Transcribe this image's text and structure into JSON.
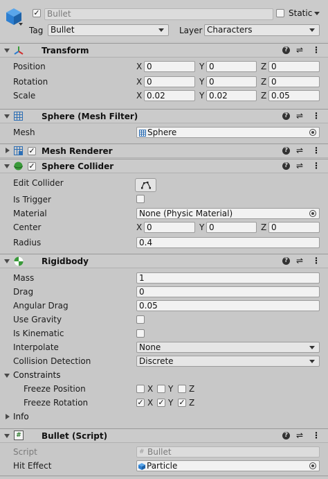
{
  "object": {
    "name": "Bullet",
    "static_label": "Static",
    "tag_label": "Tag",
    "tag_value": "Bullet",
    "layer_label": "Layer",
    "layer_value": "Characters"
  },
  "axes": {
    "x": "X",
    "y": "Y",
    "z": "Z"
  },
  "transform": {
    "title": "Transform",
    "position_label": "Position",
    "position": [
      "0",
      "0",
      "0"
    ],
    "rotation_label": "Rotation",
    "rotation": [
      "0",
      "0",
      "0"
    ],
    "scale_label": "Scale",
    "scale": [
      "0.02",
      "0.02",
      "0.05"
    ]
  },
  "mesh_filter": {
    "title": "Sphere (Mesh Filter)",
    "mesh_label": "Mesh",
    "mesh_value": "Sphere"
  },
  "mesh_renderer": {
    "title": "Mesh Renderer"
  },
  "sphere_collider": {
    "title": "Sphere Collider",
    "edit_label": "Edit Collider",
    "trigger_label": "Is Trigger",
    "material_label": "Material",
    "material_value": "None (Physic Material)",
    "center_label": "Center",
    "center": [
      "0",
      "0",
      "0"
    ],
    "radius_label": "Radius",
    "radius": "0.4"
  },
  "rigidbody": {
    "title": "Rigidbody",
    "mass_label": "Mass",
    "mass": "1",
    "drag_label": "Drag",
    "drag": "0",
    "angular_drag_label": "Angular Drag",
    "angular_drag": "0.05",
    "use_gravity_label": "Use Gravity",
    "is_kinematic_label": "Is Kinematic",
    "interpolate_label": "Interpolate",
    "interpolate": "None",
    "collision_label": "Collision Detection",
    "collision": "Discrete",
    "constraints_label": "Constraints",
    "freeze_position_label": "Freeze Position",
    "freeze_rotation_label": "Freeze Rotation",
    "info_label": "Info"
  },
  "script": {
    "title": "Bullet (Script)",
    "script_label": "Script",
    "script_value": "Bullet",
    "hit_label": "Hit Effect",
    "hit_value": "Particle"
  },
  "colors": {
    "background": "#c8c8c8",
    "header": "#cbcbcb",
    "field": "#f2f2f2",
    "cube_icon": "#2d7fd1"
  }
}
